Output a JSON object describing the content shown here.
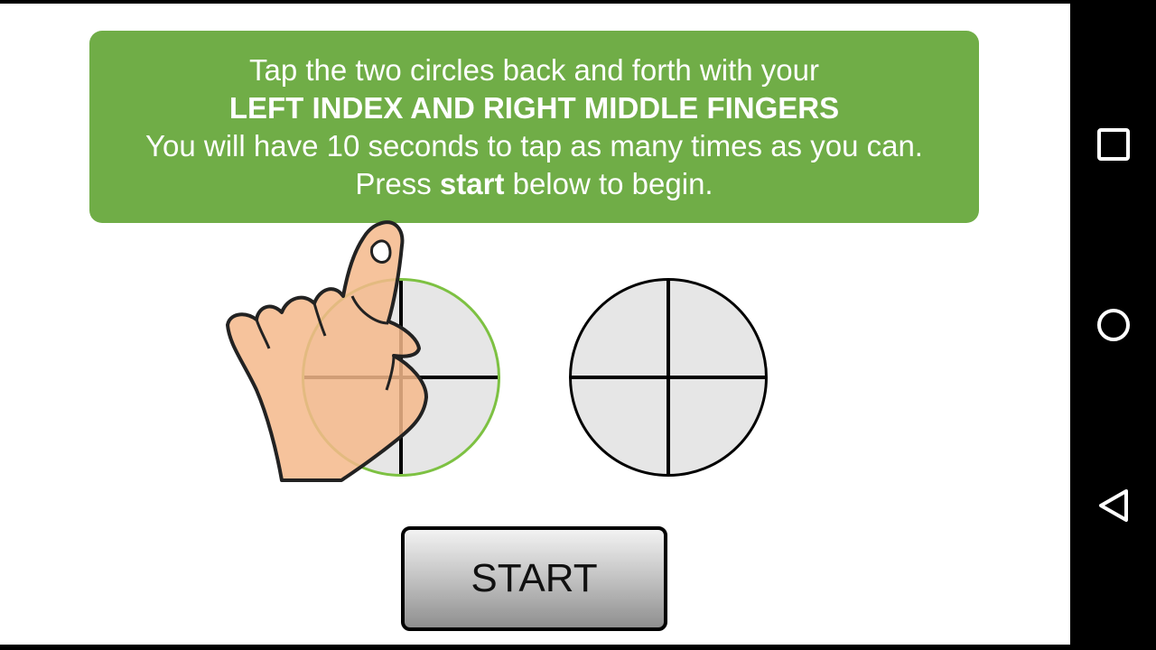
{
  "instructions": {
    "line1": "Tap the two circles back and forth with your",
    "line2_bold": "LEFT INDEX AND RIGHT MIDDLE FINGERS",
    "line3": "You will have 10 seconds to tap as many times as you can.",
    "line4_pre": "Press ",
    "line4_bold": "start",
    "line4_post": " below to begin."
  },
  "start_button": {
    "label": "START"
  },
  "colors": {
    "banner": "#70ad47",
    "active_target_ring": "#7dc142",
    "target_fill": "#e6e6e6",
    "hand_skin": "#f5b98b"
  },
  "icons": {
    "hand": "hand-pointing-icon",
    "recents": "square-recents-icon",
    "home": "circle-home-icon",
    "back": "triangle-back-icon"
  }
}
